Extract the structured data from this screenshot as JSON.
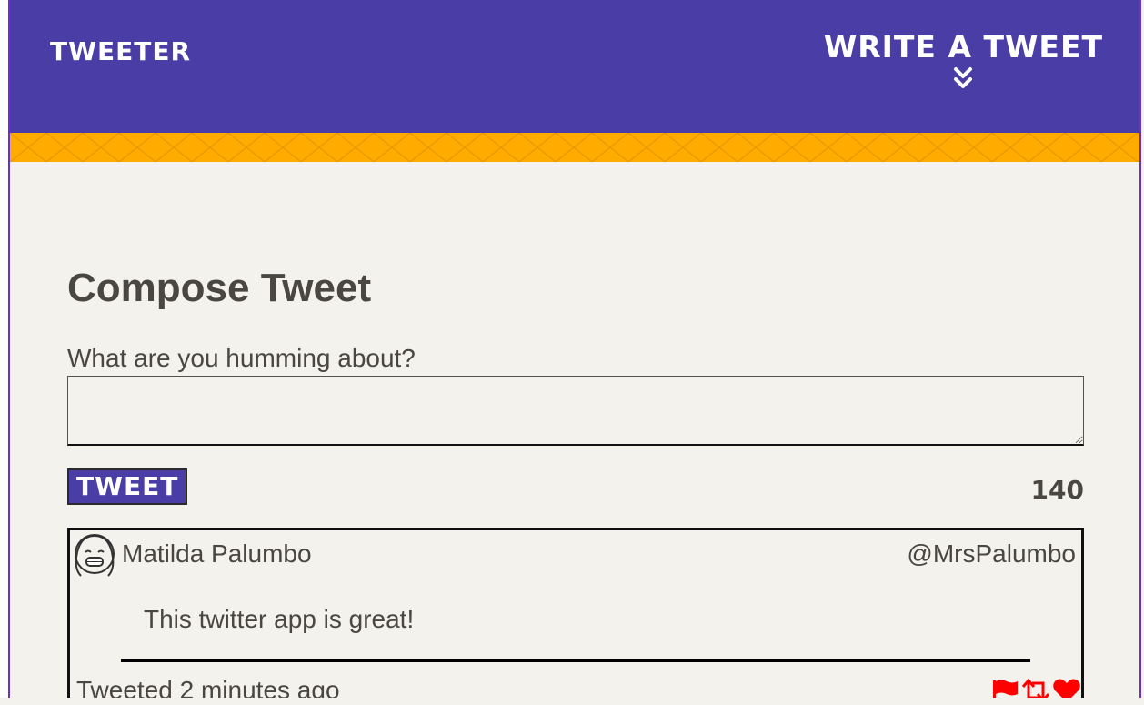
{
  "nav": {
    "brand": "Tweeter",
    "write_label": "Write a tweet"
  },
  "compose": {
    "title": "Compose Tweet",
    "label": "What are you humming about?",
    "input_value": "",
    "button_label": "Tweet",
    "counter": "140"
  },
  "tweet": {
    "name": "Matilda Palumbo",
    "handle": "@MrsPalumbo",
    "body": "This twitter app is great!",
    "time": "Tweeted 2 minutes ago",
    "actions": [
      "flag-icon",
      "retweet-icon",
      "heart-icon"
    ]
  },
  "colors": {
    "nav_bg": "#4a3ea6",
    "stripe": "#ffab00",
    "page_bg": "#f4f2ed",
    "action_icons": "#ff0000"
  }
}
